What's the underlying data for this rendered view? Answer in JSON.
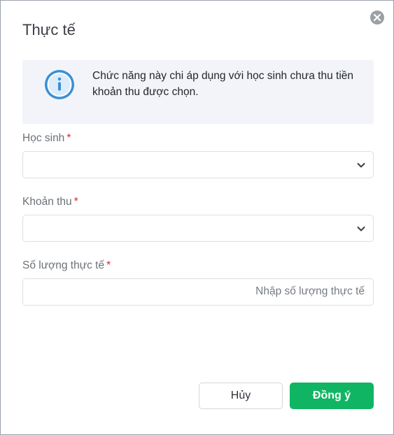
{
  "dialog": {
    "title": "Thực tế",
    "info_message": "Chức năng này chi áp dụng với học sinh chưa thu tiền khoản thu được chọn."
  },
  "fields": {
    "student": {
      "label": "Học sinh",
      "required_mark": "*",
      "value": ""
    },
    "fee": {
      "label": "Khoản thu",
      "required_mark": "*",
      "value": ""
    },
    "quantity": {
      "label": "Số lượng thực tế",
      "required_mark": "*",
      "value": "",
      "placeholder": "Nhập số lượng thực tế"
    }
  },
  "buttons": {
    "cancel_label": "Hủy",
    "ok_label": "Đồng ý"
  },
  "colors": {
    "primary": "#10b563",
    "required": "#e0242b",
    "info_bg": "#f2f4f9",
    "info_icon": "#3a8fd6"
  },
  "icons": [
    "close-icon",
    "info-icon",
    "chevron-down-icon"
  ]
}
